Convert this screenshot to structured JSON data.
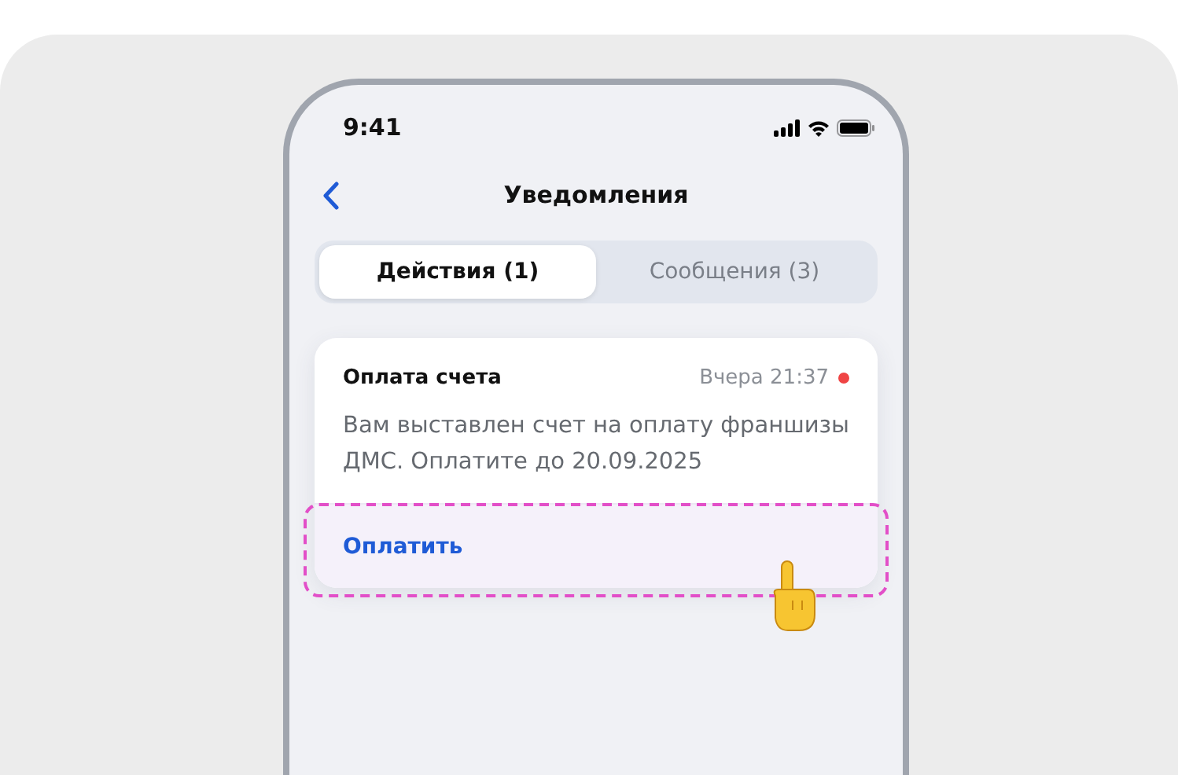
{
  "status_bar": {
    "time": "9:41"
  },
  "nav": {
    "title": "Уведомления"
  },
  "tabs": [
    {
      "label": "Действия (1)",
      "selected": true
    },
    {
      "label": "Сообщения (3)",
      "selected": false
    }
  ],
  "notifications": [
    {
      "title": "Оплата счета",
      "time": "Вчера 21:37",
      "unread": true,
      "text": "Вам выставлен счет на оплату франшизы ДМС. Оплатите до 20.09.2025",
      "action": "Оплатить",
      "highlighted": true
    }
  ]
}
